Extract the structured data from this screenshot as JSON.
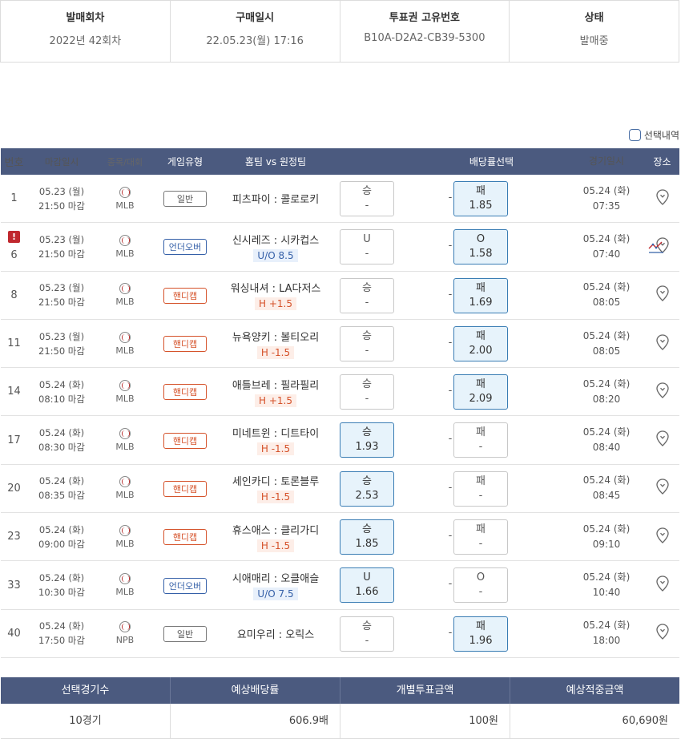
{
  "info": {
    "round_label": "발매회차",
    "round_value": "2022년 42회차",
    "purchase_label": "구매일시",
    "purchase_value": "22.05.23(월) 17:16",
    "ticket_label": "투표권 고유번호",
    "ticket_value": "B10A-D2A2-CB39-5300",
    "status_label": "상태",
    "status_value": "발매중"
  },
  "selected_history_label": "선택내역",
  "headers": {
    "no": "번호",
    "close": "마감일시",
    "sport": "종목/대회",
    "type": "게임유형",
    "match": "홈팀 vs 원정팀",
    "odds": "배당률선택",
    "gtime": "경기일시",
    "place": "장소"
  },
  "rows": [
    {
      "no": "1",
      "close_date": "05.23 (월)",
      "close_time": "21:50 마감",
      "league": "MLB",
      "type": "일반",
      "type_kind": "normal",
      "teams": "피츠파이 : 콜로로키",
      "sub": "",
      "sub_kind": "",
      "win_label": "승",
      "win_val": "-",
      "draw": "-",
      "lose_label": "패",
      "lose_val": "1.85",
      "selected": "lose",
      "game_date": "05.24 (화)",
      "game_time": "07:35",
      "alert": "",
      "trend": false
    },
    {
      "no": "6",
      "close_date": "05.23 (월)",
      "close_time": "21:50 마감",
      "league": "MLB",
      "type": "언더오버",
      "type_kind": "ou",
      "teams": "신시레즈 : 시카컵스",
      "sub": "U/O 8.5",
      "sub_kind": "ou",
      "win_label": "U",
      "win_val": "-",
      "draw": "-",
      "lose_label": "O",
      "lose_val": "1.58",
      "selected": "lose",
      "game_date": "05.24 (화)",
      "game_time": "07:40",
      "alert": "!",
      "trend": true
    },
    {
      "no": "8",
      "close_date": "05.23 (월)",
      "close_time": "21:50 마감",
      "league": "MLB",
      "type": "핸디캡",
      "type_kind": "hc",
      "teams": "워싱내셔 : LA다저스",
      "sub": "H +1.5",
      "sub_kind": "hc",
      "win_label": "승",
      "win_val": "-",
      "draw": "-",
      "lose_label": "패",
      "lose_val": "1.69",
      "selected": "lose",
      "game_date": "05.24 (화)",
      "game_time": "08:05",
      "alert": "",
      "trend": false
    },
    {
      "no": "11",
      "close_date": "05.23 (월)",
      "close_time": "21:50 마감",
      "league": "MLB",
      "type": "핸디캡",
      "type_kind": "hc",
      "teams": "뉴욕양키 : 볼티오리",
      "sub": "H -1.5",
      "sub_kind": "hc",
      "win_label": "승",
      "win_val": "-",
      "draw": "-",
      "lose_label": "패",
      "lose_val": "2.00",
      "selected": "lose",
      "game_date": "05.24 (화)",
      "game_time": "08:05",
      "alert": "",
      "trend": false
    },
    {
      "no": "14",
      "close_date": "05.24 (화)",
      "close_time": "08:10 마감",
      "league": "MLB",
      "type": "핸디캡",
      "type_kind": "hc",
      "teams": "애틀브레 : 필라필리",
      "sub": "H +1.5",
      "sub_kind": "hc",
      "win_label": "승",
      "win_val": "-",
      "draw": "-",
      "lose_label": "패",
      "lose_val": "2.09",
      "selected": "lose",
      "game_date": "05.24 (화)",
      "game_time": "08:20",
      "alert": "",
      "trend": false
    },
    {
      "no": "17",
      "close_date": "05.24 (화)",
      "close_time": "08:30 마감",
      "league": "MLB",
      "type": "핸디캡",
      "type_kind": "hc",
      "teams": "미네트윈 : 디트타이",
      "sub": "H -1.5",
      "sub_kind": "hc",
      "win_label": "승",
      "win_val": "1.93",
      "draw": "-",
      "lose_label": "패",
      "lose_val": "-",
      "selected": "win",
      "game_date": "05.24 (화)",
      "game_time": "08:40",
      "alert": "",
      "trend": false
    },
    {
      "no": "20",
      "close_date": "05.24 (화)",
      "close_time": "08:35 마감",
      "league": "MLB",
      "type": "핸디캡",
      "type_kind": "hc",
      "teams": "세인카디 : 토론블루",
      "sub": "H -1.5",
      "sub_kind": "hc",
      "win_label": "승",
      "win_val": "2.53",
      "draw": "-",
      "lose_label": "패",
      "lose_val": "-",
      "selected": "win",
      "game_date": "05.24 (화)",
      "game_time": "08:45",
      "alert": "",
      "trend": false
    },
    {
      "no": "23",
      "close_date": "05.24 (화)",
      "close_time": "09:00 마감",
      "league": "MLB",
      "type": "핸디캡",
      "type_kind": "hc",
      "teams": "휴스애스 : 클리가디",
      "sub": "H -1.5",
      "sub_kind": "hc",
      "win_label": "승",
      "win_val": "1.85",
      "draw": "-",
      "lose_label": "패",
      "lose_val": "-",
      "selected": "win",
      "game_date": "05.24 (화)",
      "game_time": "09:10",
      "alert": "",
      "trend": false
    },
    {
      "no": "33",
      "close_date": "05.24 (화)",
      "close_time": "10:30 마감",
      "league": "MLB",
      "type": "언더오버",
      "type_kind": "ou",
      "teams": "시애매리 : 오클애슬",
      "sub": "U/O 7.5",
      "sub_kind": "ou",
      "win_label": "U",
      "win_val": "1.66",
      "draw": "-",
      "lose_label": "O",
      "lose_val": "-",
      "selected": "win",
      "game_date": "05.24 (화)",
      "game_time": "10:40",
      "alert": "",
      "trend": false
    },
    {
      "no": "40",
      "close_date": "05.24 (화)",
      "close_time": "17:50 마감",
      "league": "NPB",
      "type": "일반",
      "type_kind": "normal",
      "teams": "요미우리 : 오릭스",
      "sub": "",
      "sub_kind": "",
      "win_label": "승",
      "win_val": "-",
      "draw": "-",
      "lose_label": "패",
      "lose_val": "1.96",
      "selected": "lose",
      "game_date": "05.24 (화)",
      "game_time": "18:00",
      "alert": "",
      "trend": false
    }
  ],
  "summary": {
    "h1": "선택경기수",
    "h2": "예상배당률",
    "h3": "개별투표금액",
    "h4": "예상적중금액",
    "v1": "10경기",
    "v2": "606.9배",
    "v3": "100원",
    "v4": "60,690원"
  },
  "colors": {
    "header_bg": "#4b5a7f",
    "selected_bg": "#e7f3fb",
    "handicap": "#d5522a",
    "underover": "#3560a8",
    "alert": "#c0282e"
  }
}
